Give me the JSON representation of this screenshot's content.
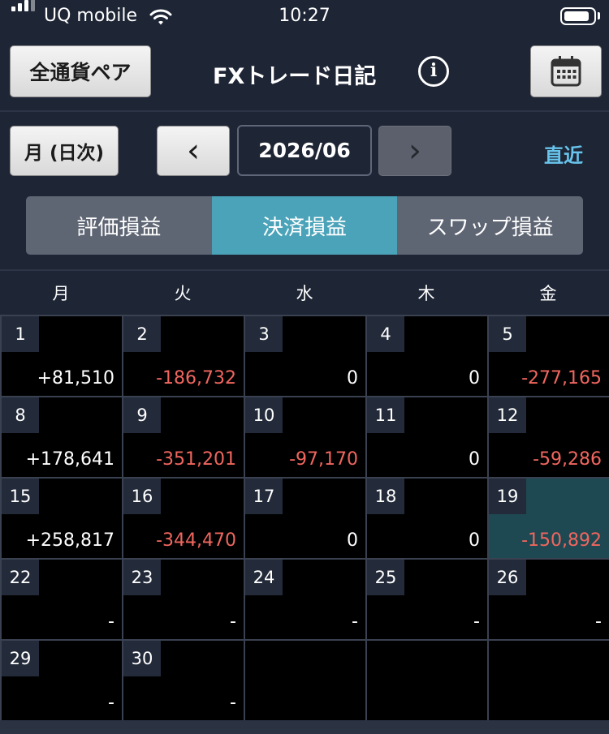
{
  "status_bar": {
    "carrier": "UQ mobile",
    "time": "10:27"
  },
  "header": {
    "currency_pair_button": "全通貨ペア",
    "title": "FXトレード日記",
    "info_glyph": "i"
  },
  "toolbar": {
    "period_button": "月 (日次)",
    "prev_glyph": "‹",
    "month": "2026/06",
    "next_glyph": "›",
    "recent_link": "直近"
  },
  "tabs": [
    {
      "label": "評価損益",
      "active": false
    },
    {
      "label": "決済損益",
      "active": true
    },
    {
      "label": "スワップ損益",
      "active": false
    }
  ],
  "weekdays": [
    "月",
    "火",
    "水",
    "木",
    "金"
  ],
  "calendar": [
    [
      {
        "day": "1",
        "value": "+81,510"
      },
      {
        "day": "2",
        "value": "-186,732"
      },
      {
        "day": "3",
        "value": "0"
      },
      {
        "day": "4",
        "value": "0"
      },
      {
        "day": "5",
        "value": "-277,165"
      }
    ],
    [
      {
        "day": "8",
        "value": "+178,641"
      },
      {
        "day": "9",
        "value": "-351,201"
      },
      {
        "day": "10",
        "value": "-97,170"
      },
      {
        "day": "11",
        "value": "0"
      },
      {
        "day": "12",
        "value": "-59,286"
      }
    ],
    [
      {
        "day": "15",
        "value": "+258,817"
      },
      {
        "day": "16",
        "value": "-344,470"
      },
      {
        "day": "17",
        "value": "0"
      },
      {
        "day": "18",
        "value": "0"
      },
      {
        "day": "19",
        "value": "-150,892",
        "today": true
      }
    ],
    [
      {
        "day": "22",
        "value": "-"
      },
      {
        "day": "23",
        "value": "-"
      },
      {
        "day": "24",
        "value": "-"
      },
      {
        "day": "25",
        "value": "-"
      },
      {
        "day": "26",
        "value": "-"
      }
    ],
    [
      {
        "day": "29",
        "value": "-"
      },
      {
        "day": "30",
        "value": "-"
      },
      {
        "day": "",
        "value": ""
      },
      {
        "day": "",
        "value": ""
      },
      {
        "day": "",
        "value": ""
      }
    ]
  ],
  "colors": {
    "background": "#1e2535",
    "accent_tab": "#4ba3b9",
    "negative": "#f0665f",
    "recent_link": "#68c4ec",
    "today_cell": "#1f4952"
  }
}
